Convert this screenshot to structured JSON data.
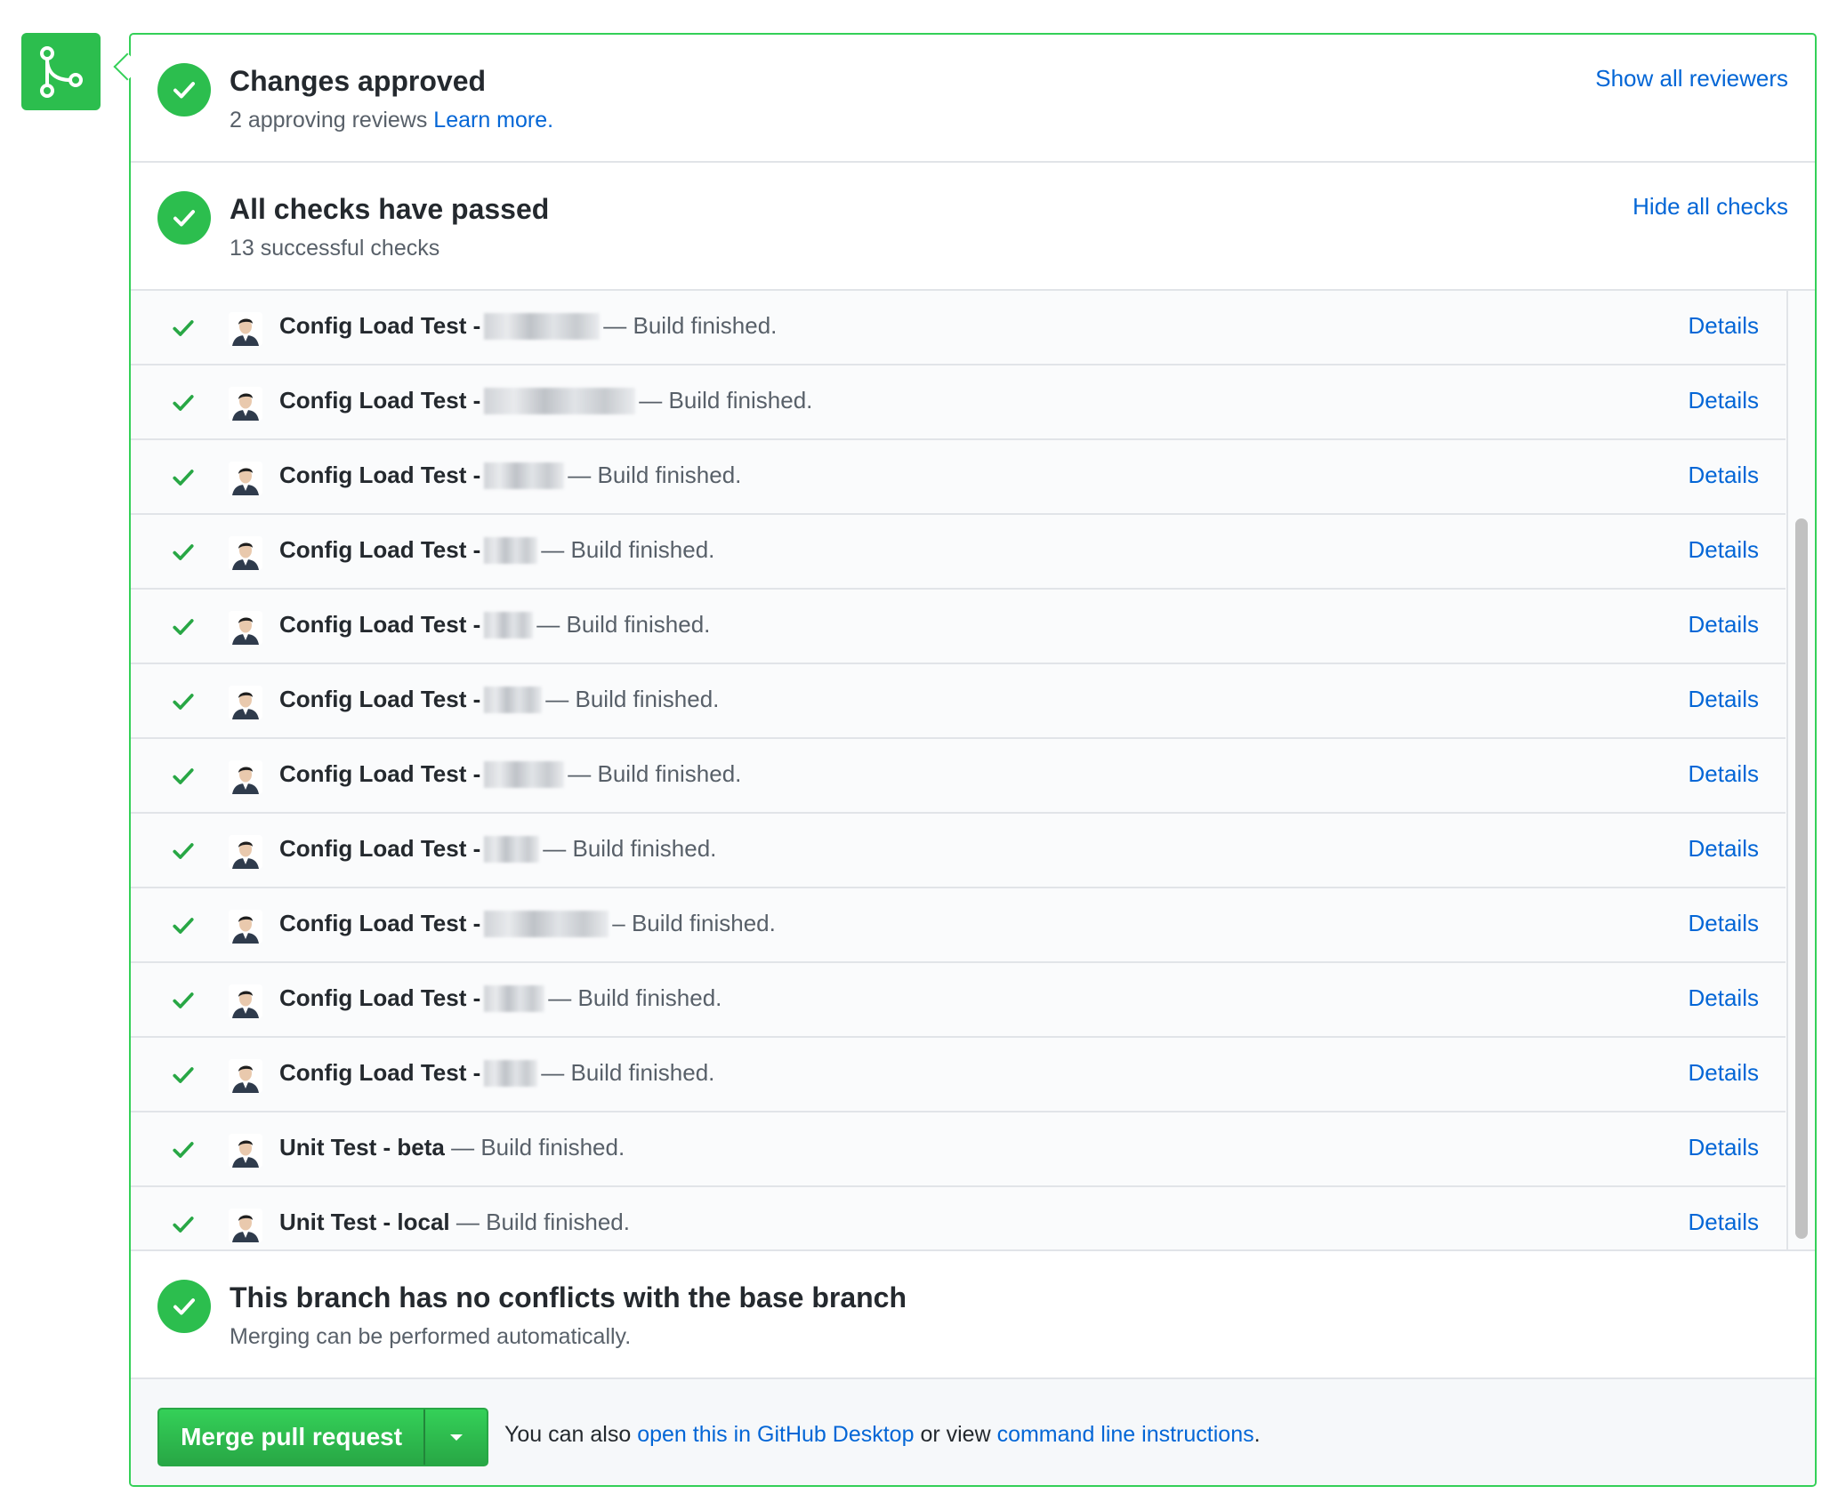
{
  "colors": {
    "success_green": "#2cbe4e",
    "border_green": "#34d058",
    "link_blue": "#0366d6",
    "muted_text": "#586069"
  },
  "approved": {
    "title": "Changes approved",
    "subtitle": "2 approving reviews",
    "learn_more": "Learn more.",
    "show_all_reviewers": "Show all reviewers",
    "icon": "check-circle-icon"
  },
  "checks": {
    "title": "All checks have passed",
    "subtitle": "13 successful checks",
    "hide_all_checks": "Hide all checks",
    "icon": "check-circle-icon",
    "details_label": "Details",
    "items": [
      {
        "name": "Config Load Test -",
        "desc": "— Build finished."
      },
      {
        "name": "Config Load Test -",
        "desc": "— Build finished."
      },
      {
        "name": "Config Load Test -",
        "desc": "— Build finished."
      },
      {
        "name": "Config Load Test -",
        "desc": "— Build finished."
      },
      {
        "name": "Config Load Test -",
        "desc": "— Build finished."
      },
      {
        "name": "Config Load Test -",
        "desc": "— Build finished."
      },
      {
        "name": "Config Load Test -",
        "desc": "— Build finished."
      },
      {
        "name": "Config Load Test -",
        "desc": "— Build finished."
      },
      {
        "name": "Config Load Test -",
        "desc": "– Build finished."
      },
      {
        "name": "Config Load Test -",
        "desc": "— Build finished."
      },
      {
        "name": "Config Load Test -",
        "desc": "— Build finished."
      },
      {
        "name": "Unit Test - beta",
        "desc": "— Build finished."
      },
      {
        "name": "Unit Test - local",
        "desc": "— Build finished."
      }
    ]
  },
  "no_conflict": {
    "title": "This branch has no conflicts with the base branch",
    "subtitle": "Merging can be performed automatically.",
    "icon": "check-circle-icon"
  },
  "merge": {
    "button_label": "Merge pull request",
    "caret_icon": "caret-down-icon",
    "note_prefix": "You can also",
    "desktop_link": "open this in GitHub Desktop",
    "note_middle": "or view",
    "cli_link": "command line instructions",
    "note_suffix": "."
  }
}
